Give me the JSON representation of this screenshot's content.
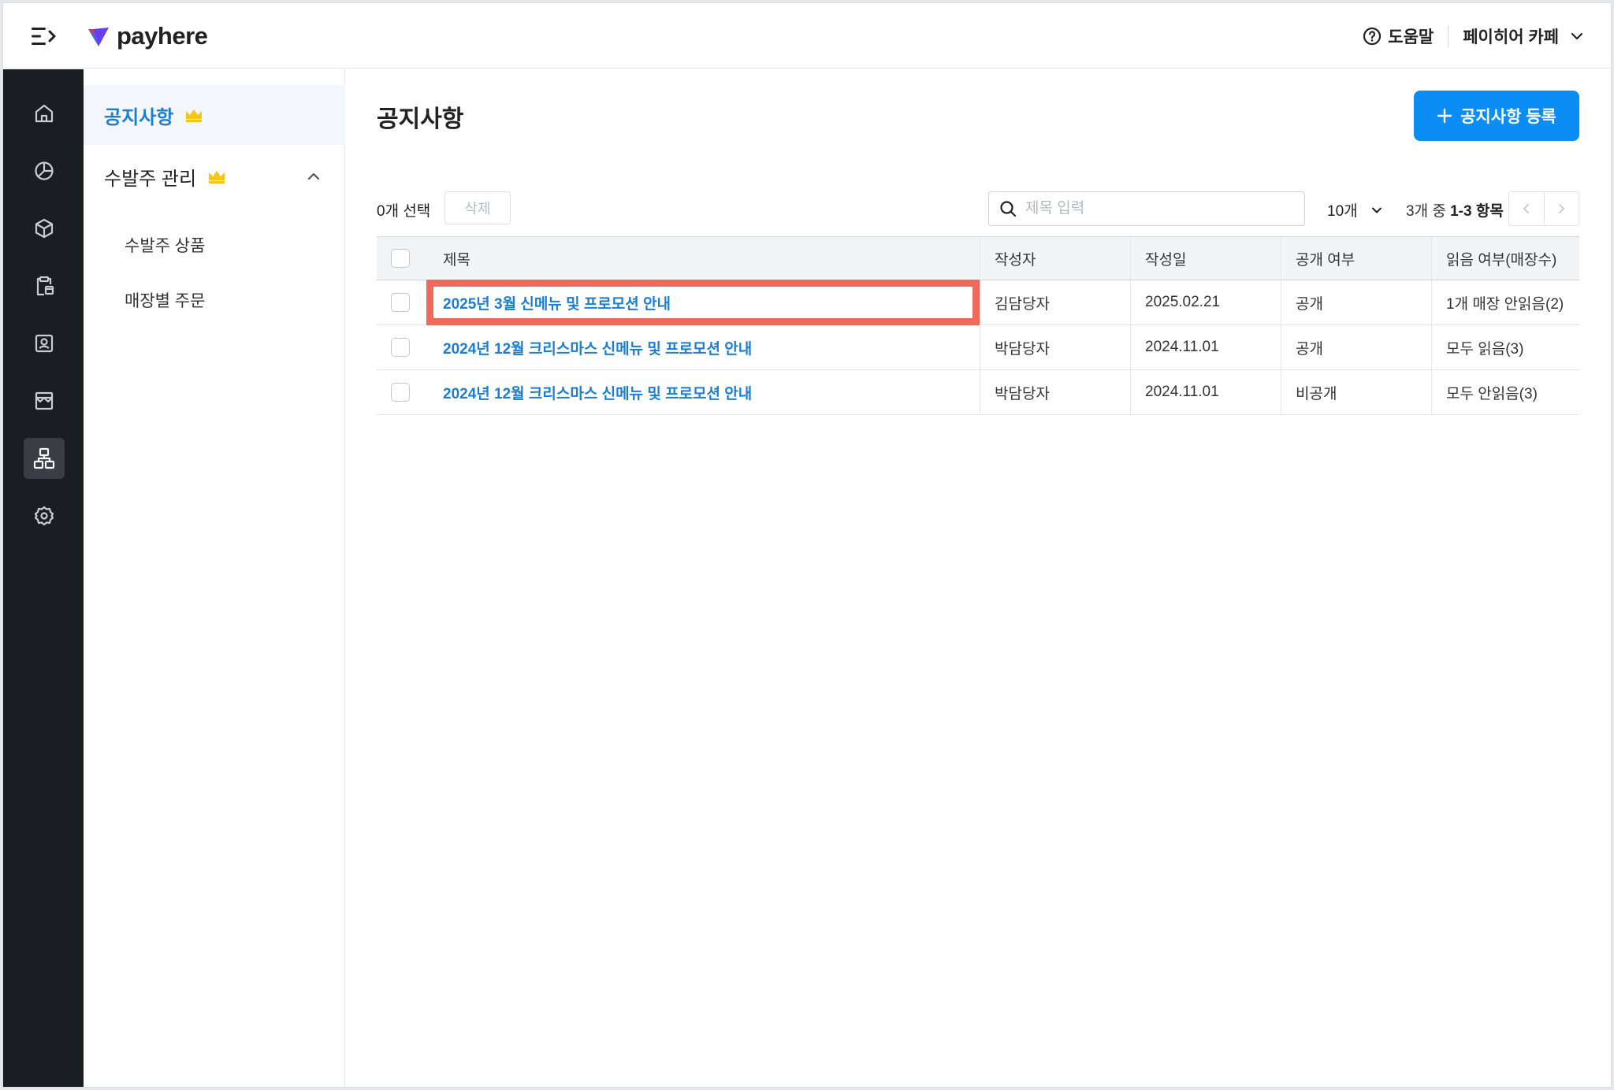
{
  "header": {
    "logo_text": "payhere",
    "help_label": "도움말",
    "store_name": "페이히어 카페"
  },
  "rail": {
    "items": [
      {
        "icon": "home-icon"
      },
      {
        "icon": "pie-chart-icon"
      },
      {
        "icon": "box-icon"
      },
      {
        "icon": "clipboard-icon"
      },
      {
        "icon": "contact-card-icon"
      },
      {
        "icon": "store-icon"
      },
      {
        "icon": "org-chart-icon",
        "active": true
      },
      {
        "icon": "gear-icon"
      }
    ]
  },
  "subnav": {
    "notice_label": "공지사항",
    "order_group_label": "수발주 관리",
    "order_products_label": "수발주 상품",
    "store_orders_label": "매장별 주문"
  },
  "main": {
    "title": "공지사항",
    "add_button_label": "공지사항 등록",
    "selected_count": "0개 선택",
    "delete_label": "삭제",
    "search_placeholder": "제목 입력",
    "page_size": "10개",
    "range_prefix": "3개 중",
    "range_value": "1-3 항목"
  },
  "table": {
    "columns": [
      "제목",
      "작성자",
      "작성일",
      "공개 여부",
      "읽음 여부(매장수)"
    ],
    "rows": [
      {
        "title": "2025년 3월 신메뉴 및 프로모션 안내",
        "author": "김담당자",
        "date": "2025.02.21",
        "visibility": "공개",
        "read": "1개 매장 안읽음(2)"
      },
      {
        "title": "2024년 12월 크리스마스 신메뉴 및 프로모션 안내",
        "author": "박담당자",
        "date": "2024.11.01",
        "visibility": "공개",
        "read": "모두 읽음(3)"
      },
      {
        "title": "2024년 12월 크리스마스 신메뉴 및 프로모션 안내",
        "author": "박담당자",
        "date": "2024.11.01",
        "visibility": "비공개",
        "read": "모두 안읽음(3)"
      }
    ]
  },
  "colors": {
    "accent": "#0a8df5",
    "link": "#1a7fd4",
    "rail_bg": "#1b1d22",
    "highlight": "#f06a5b",
    "crown": "#f5c518"
  }
}
